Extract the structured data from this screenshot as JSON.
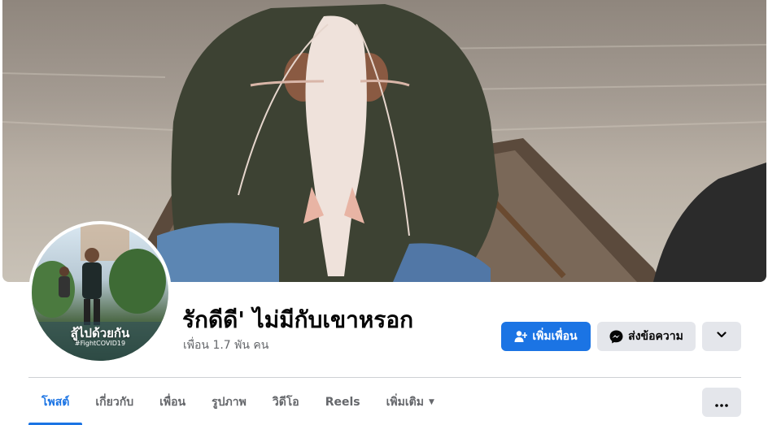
{
  "profile": {
    "name": "รักดีดี' ไม่มีกับเขาหรอก",
    "friends": "เพื่อน 1.7 พัน คน",
    "avatar_caption": "สู้ไปด้วยกัน",
    "avatar_tag": "#FightCOVID19"
  },
  "actions": {
    "add_friend": "เพิ่มเพื่อน",
    "message": "ส่งข้อความ"
  },
  "tabs": [
    {
      "label": "โพสต์",
      "active": true
    },
    {
      "label": "เกี่ยวกับ"
    },
    {
      "label": "เพื่อน"
    },
    {
      "label": "รูปภาพ"
    },
    {
      "label": "วิดีโอ"
    },
    {
      "label": "Reels"
    },
    {
      "label": "เพิ่มเติม"
    }
  ],
  "colors": {
    "accent": "#1b74e4",
    "secondary_button": "#e4e6eb",
    "muted_text": "#65676b"
  },
  "icons": {
    "add_friend": "person-plus-icon",
    "message": "messenger-icon",
    "more_actions": "chevron-down-icon",
    "tab_more": "caret-down-icon",
    "tab_overflow": "ellipsis-icon"
  }
}
